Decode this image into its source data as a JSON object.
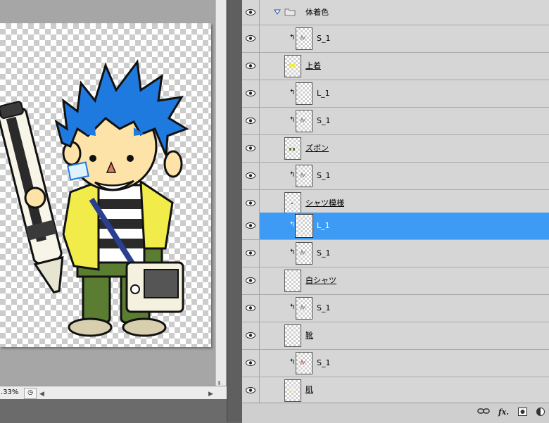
{
  "document": {
    "zoom": "33%",
    "zoom_display": ".33%",
    "status_button_icon": "clock-icon",
    "scroll_left_icon": "◀",
    "scroll_right_icon": "▶"
  },
  "layers": [
    {
      "name": "体着色",
      "type": "group",
      "expanded": true,
      "visible": true
    },
    {
      "name": "S_1",
      "type": "clipped",
      "thumb": "sketch",
      "visible": true
    },
    {
      "name": "上着",
      "type": "base",
      "thumb": "yellow",
      "underline": true,
      "visible": true
    },
    {
      "name": "L_1",
      "type": "clipped",
      "thumb": "blank",
      "visible": true
    },
    {
      "name": "S_1",
      "type": "clipped",
      "thumb": "sketch",
      "visible": true
    },
    {
      "name": "ズボン",
      "type": "base",
      "thumb": "green",
      "underline": true,
      "visible": true
    },
    {
      "name": "S_1",
      "type": "clipped",
      "thumb": "sketch",
      "visible": true
    },
    {
      "name": "シャツ模様",
      "type": "base",
      "thumb": "dots",
      "underline": true,
      "visible": true
    },
    {
      "name": "L_1",
      "type": "clipped",
      "thumb": "blank",
      "selected": true,
      "visible": true
    },
    {
      "name": "S_1",
      "type": "clipped",
      "thumb": "sketch",
      "visible": true
    },
    {
      "name": "白シャツ",
      "type": "base",
      "thumb": "blank",
      "underline": true,
      "visible": true
    },
    {
      "name": "S_1",
      "type": "clipped",
      "thumb": "sketch",
      "visible": true
    },
    {
      "name": "靴",
      "type": "base",
      "thumb": "blank",
      "underline": true,
      "visible": true
    },
    {
      "name": "S_1",
      "type": "clipped",
      "thumb": "red-sketch",
      "visible": true
    },
    {
      "name": "肌",
      "type": "base",
      "thumb": "skin",
      "underline": true,
      "visible": true
    }
  ],
  "clip_arrow": "↰",
  "panel_footer": {
    "icons": [
      "link-icon",
      "fx-icon",
      "mask-icon",
      "adjustment-icon"
    ],
    "fx_label": "fx."
  },
  "colors": {
    "selected_row": "#3d9bf6",
    "panel_bg": "#d6d6d6",
    "hair": "#1f7ae0",
    "jacket": "#f2ec4a",
    "pants": "#5a7d32",
    "skin": "#fde3a8"
  }
}
